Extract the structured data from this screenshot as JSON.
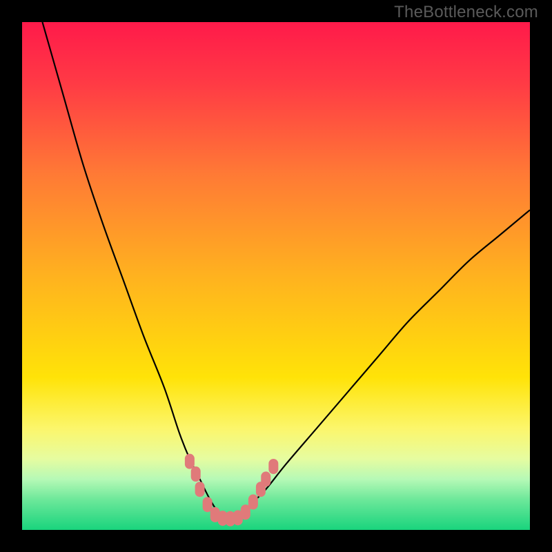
{
  "watermark": "TheBottleneck.com",
  "chart_data": {
    "type": "line",
    "title": "",
    "xlabel": "",
    "ylabel": "",
    "xlim": [
      0,
      100
    ],
    "ylim": [
      0,
      100
    ],
    "gradient_stops": [
      {
        "offset": 0.0,
        "color": "#ff1a4a"
      },
      {
        "offset": 0.12,
        "color": "#ff3a45"
      },
      {
        "offset": 0.3,
        "color": "#ff7a35"
      },
      {
        "offset": 0.5,
        "color": "#ffb21f"
      },
      {
        "offset": 0.7,
        "color": "#ffe308"
      },
      {
        "offset": 0.8,
        "color": "#fcf66b"
      },
      {
        "offset": 0.86,
        "color": "#e6fca0"
      },
      {
        "offset": 0.9,
        "color": "#b6f9b6"
      },
      {
        "offset": 0.94,
        "color": "#6de89a"
      },
      {
        "offset": 1.0,
        "color": "#19d47d"
      }
    ],
    "series": [
      {
        "name": "bottleneck-curve",
        "x": [
          4,
          8,
          12,
          16,
          20,
          24,
          28,
          31,
          33,
          35,
          37,
          39,
          41,
          43,
          45,
          48,
          52,
          58,
          64,
          70,
          76,
          82,
          88,
          94,
          100
        ],
        "y": [
          100,
          86,
          72,
          60,
          49,
          38,
          28,
          19,
          14,
          10,
          6,
          3,
          2,
          3,
          5,
          8,
          13,
          20,
          27,
          34,
          41,
          47,
          53,
          58,
          63
        ]
      }
    ],
    "highlight_points": {
      "name": "optimal-zone",
      "color": "#e07a7a",
      "points": [
        {
          "x": 33.0,
          "y": 13.5
        },
        {
          "x": 34.2,
          "y": 11.0
        },
        {
          "x": 35.0,
          "y": 8.0
        },
        {
          "x": 36.5,
          "y": 5.0
        },
        {
          "x": 38.0,
          "y": 3.0
        },
        {
          "x": 39.5,
          "y": 2.3
        },
        {
          "x": 41.0,
          "y": 2.2
        },
        {
          "x": 42.5,
          "y": 2.4
        },
        {
          "x": 44.0,
          "y": 3.5
        },
        {
          "x": 45.5,
          "y": 5.5
        },
        {
          "x": 47.0,
          "y": 8.0
        },
        {
          "x": 48.0,
          "y": 10.0
        },
        {
          "x": 49.5,
          "y": 12.5
        }
      ]
    }
  }
}
